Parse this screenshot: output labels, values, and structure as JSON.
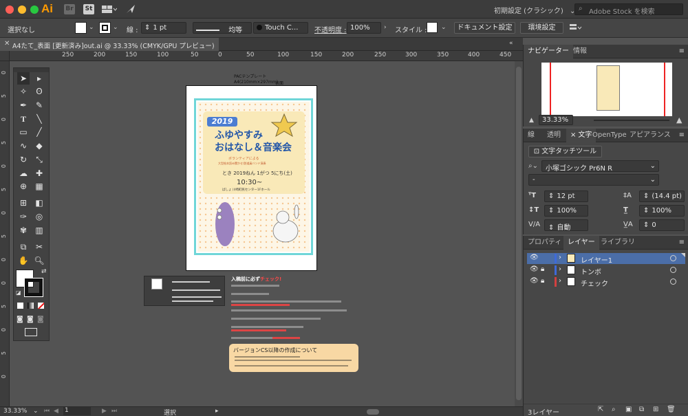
{
  "titlebar": {
    "app_label": "Ai",
    "bridge_label": "Br",
    "stock_app_label": "St",
    "workspace_preset": "初期設定 (クラシック)",
    "stock_search_placeholder": "Adobe Stock を検索",
    "colors": {
      "close": "#fe5f57",
      "minimize": "#febc2e",
      "zoom": "#28c840",
      "ai_orange": "#ff9a00"
    }
  },
  "control_bar": {
    "selection_label": "選択なし",
    "stroke_label": "線 :",
    "stroke_weight": "1 pt",
    "stroke_profile": "均等",
    "brush": "Touch C...",
    "opacity_label": "不透明度 :",
    "opacity_value": "100%",
    "style_label": "スタイル :",
    "document_setup_button": "ドキュメント設定",
    "preferences_button": "環境設定"
  },
  "document_tab": {
    "title": "A4たて_表面 [更新済み]out.ai @ 33.33% (CMYK/GPU プレビュー)"
  },
  "ruler": {
    "h_labels": [
      "250",
      "200",
      "150",
      "100",
      "50",
      "0",
      "50",
      "100",
      "150",
      "200",
      "250",
      "300",
      "350",
      "400",
      "450",
      "500"
    ],
    "v_labels": [
      "0",
      "5",
      "0",
      "5",
      "0",
      "5",
      "0",
      "5",
      "0",
      "0",
      "5",
      "0",
      "5",
      "0",
      "5"
    ]
  },
  "artboard": {
    "template_header": "PACテンプレート",
    "template_size": "A4(210mm×297mm)",
    "template_side": "表面",
    "flyer": {
      "year": "2019",
      "title_line1": "ふゆやすみ",
      "title_line2": "おはなし＆音楽会",
      "subtitle": "ボランティアによる",
      "subtitle2": "大型絵本読み聞かせ/鉄道員バンド演奏",
      "date": "とき 2019ねん 1がつ 5にち(土)",
      "time": "10:30~",
      "place": "ばしょ 川崎町民センター1Fホール"
    }
  },
  "notes": {
    "title": "入稿前に必ず",
    "title_highlight": "チェック!",
    "cs_box_title": "バージョンCS以降の作成について"
  },
  "statusbar": {
    "zoom": "33.33%",
    "artboard_number": "1",
    "mode": "選択"
  },
  "navigator_panel": {
    "tab_navigator": "ナビゲーター",
    "tab_info": "情報",
    "zoom_value": "33.33%"
  },
  "character_panel": {
    "tab_stroke": "線",
    "tab_transparency": "透明",
    "tab_character": "文字",
    "tab_opentype": "OpenType",
    "tab_appearance": "アピアランス",
    "touch_type_button": "文字タッチツール",
    "font_family": "小塚ゴシック Pr6N R",
    "font_style": "-",
    "font_size": "12 pt",
    "leading": "(14.4 pt)",
    "vertical_scale": "100%",
    "horizontal_scale": "100%",
    "kerning": "自動",
    "tracking": "0"
  },
  "layers_panel": {
    "tab_properties": "プロパティ",
    "tab_layers": "レイヤー",
    "tab_libraries": "ライブラリ",
    "layers": [
      {
        "name": "レイヤー1",
        "selected": true,
        "locked": false
      },
      {
        "name": "トンボ",
        "selected": false,
        "locked": true
      },
      {
        "name": "チェック",
        "selected": false,
        "locked": true
      }
    ],
    "layer_count": "3レイヤー"
  }
}
